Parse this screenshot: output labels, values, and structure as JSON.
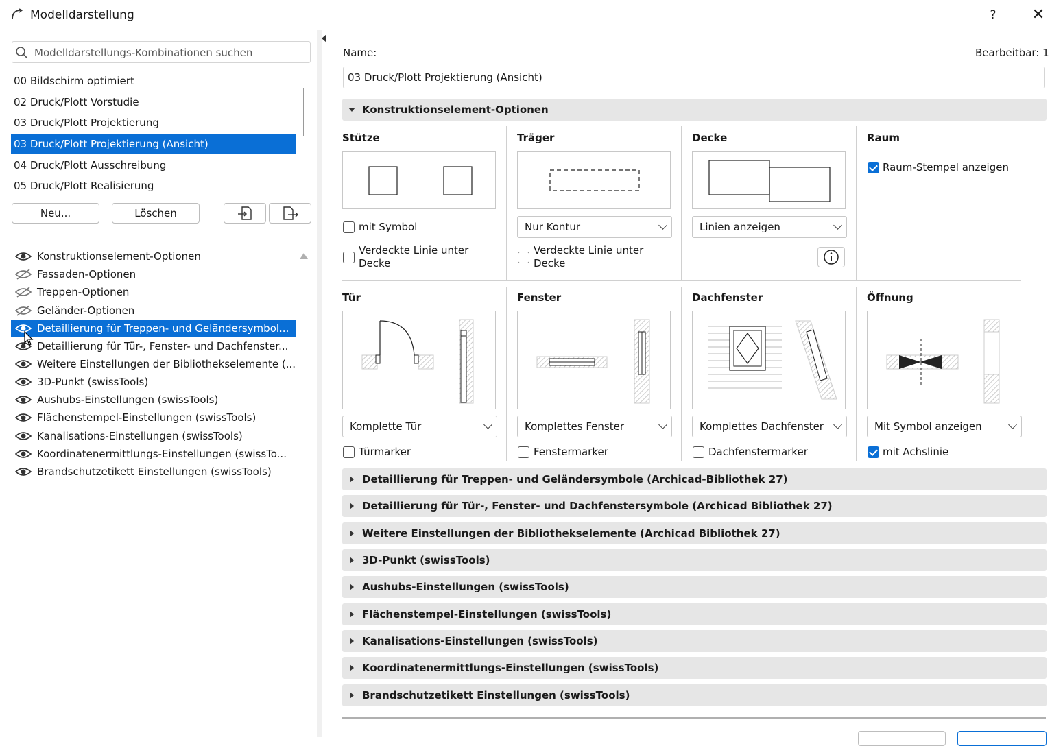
{
  "window": {
    "title": "Modelldarstellung",
    "help": "?",
    "close": "✕"
  },
  "search": {
    "placeholder": "Modelldarstellungs-Kombinationen suchen"
  },
  "combinations": [
    "00 Bildschirm optimiert",
    "02 Druck/Plott Vorstudie",
    "03 Druck/Plott Projektierung",
    "03 Druck/Plott Projektierung (Ansicht)",
    "04 Druck/Plott Ausschreibung",
    "05 Druck/Plott Realisierung"
  ],
  "combinations_selected": 3,
  "buttons": {
    "new": "Neu...",
    "delete": "Löschen"
  },
  "option_sets": [
    {
      "label": "Konstruktionselement-Optionen",
      "visible": true
    },
    {
      "label": "Fassaden-Optionen",
      "visible": false
    },
    {
      "label": "Treppen-Optionen",
      "visible": false
    },
    {
      "label": "Geländer-Optionen",
      "visible": false
    },
    {
      "label": "Detaillierung für Treppen- und Geländersymbol...",
      "visible": true
    },
    {
      "label": "Detaillierung für Tür-, Fenster- und Dachfenster...",
      "visible": true
    },
    {
      "label": "Weitere Einstellungen der Bibliothekselemente (...",
      "visible": true
    },
    {
      "label": "3D-Punkt (swissTools)",
      "visible": true
    },
    {
      "label": "Aushubs-Einstellungen (swissTools)",
      "visible": true
    },
    {
      "label": "Flächenstempel-Einstellungen (swissTools)",
      "visible": true
    },
    {
      "label": "Kanalisations-Einstellungen (swissTools)",
      "visible": true
    },
    {
      "label": "Koordinatenermittlungs-Einstellungen (swissTo...",
      "visible": true
    },
    {
      "label": "Brandschutzetikett Einstellungen (swissTools)",
      "visible": true
    }
  ],
  "option_sets_selected": 4,
  "details": {
    "name_label": "Name:",
    "editable_label": "Bearbeitbar: 1",
    "name_value": "03 Druck/Plott Projektierung (Ansicht)"
  },
  "section_open": "Konstruktionselement-Optionen",
  "elements": {
    "stuetze": {
      "title": "Stütze",
      "cb1": "mit Symbol",
      "cb2a": "Verdeckte Linie unter",
      "cb2b": "Decke"
    },
    "traeger": {
      "title": "Träger",
      "dropdown": "Nur Kontur",
      "cb2a": "Verdeckte Linie unter",
      "cb2b": "Decke"
    },
    "decke": {
      "title": "Decke",
      "dropdown": "Linien anzeigen"
    },
    "raum": {
      "title": "Raum",
      "cb1": "Raum-Stempel anzeigen"
    },
    "tuer": {
      "title": "Tür",
      "dropdown": "Komplette Tür",
      "cb": "Türmarker"
    },
    "fenster": {
      "title": "Fenster",
      "dropdown": "Komplettes Fenster",
      "cb": "Fenstermarker"
    },
    "dachfenster": {
      "title": "Dachfenster",
      "dropdown": "Komplettes Dachfenster",
      "cb": "Dachfenstermarker"
    },
    "oeffnung": {
      "title": "Öffnung",
      "dropdown": "Mit Symbol anzeigen",
      "cb": "mit Achslinie"
    }
  },
  "collapsed_sections": [
    "Detaillierung für Treppen- und Geländersymbole (Archicad-Bibliothek 27)",
    "Detaillierung für Tür-, Fenster- und Dachfenstersymbole (Archicad Bibliothek 27)",
    "Weitere Einstellungen der Bibliothekselemente (Archicad Bibliothek 27)",
    "3D-Punkt (swissTools)",
    "Aushubs-Einstellungen (swissTools)",
    "Flächenstempel-Einstellungen (swissTools)",
    "Kanalisations-Einstellungen (swissTools)",
    "Koordinatenermittlungs-Einstellungen (swissTools)",
    "Brandschutzetikett Einstellungen (swissTools)"
  ],
  "colors": {
    "accent": "#0a6fd6",
    "section_bg": "#e6e6e6"
  }
}
